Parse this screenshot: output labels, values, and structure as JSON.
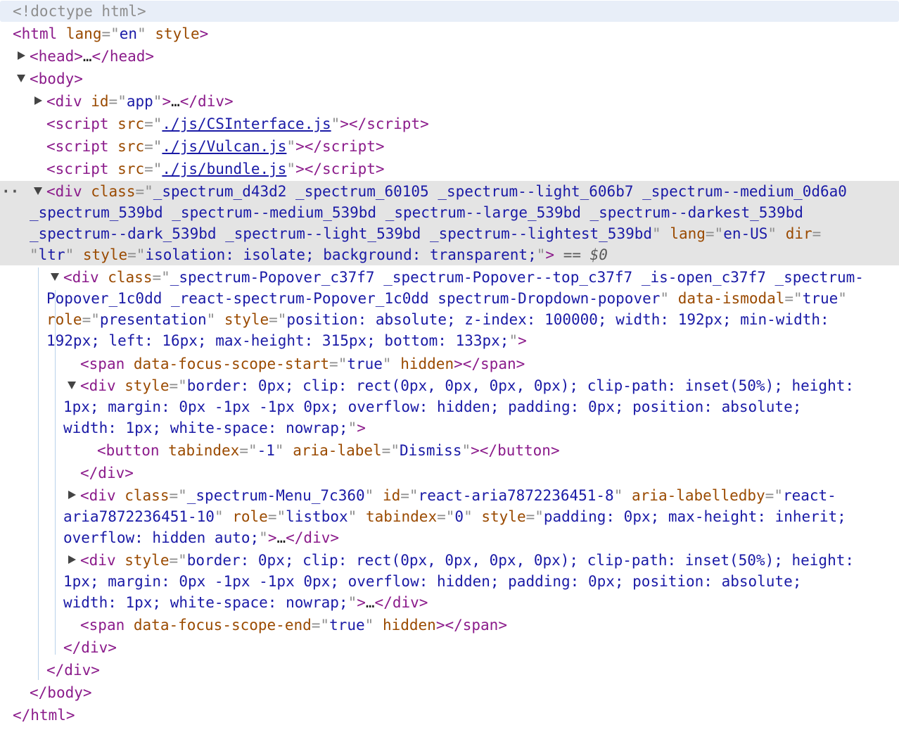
{
  "doctype": "<!doctype html>",
  "html_open": {
    "tag": "html",
    "attr_lang": "lang",
    "val_lang": "en",
    "attr_style": "style"
  },
  "head": {
    "tag": "head",
    "ellipsis": "…"
  },
  "body": {
    "tag": "body"
  },
  "app_div": {
    "tag": "div",
    "attr": "id",
    "val": "app",
    "ellipsis": "…"
  },
  "scripts": [
    {
      "tag": "script",
      "attr": "src",
      "val": "./js/CSInterface.js"
    },
    {
      "tag": "script",
      "attr": "src",
      "val": "./js/Vulcan.js"
    },
    {
      "tag": "script",
      "attr": "src",
      "val": "./js/bundle.js"
    }
  ],
  "spectrum_div": {
    "tag": "div",
    "attr_class": "class",
    "class_lines": [
      "_spectrum_d43d2 _spectrum_60105 _spectrum--light_606b7 _spectrum--medium_0d6a0",
      "_spectrum_539bd _spectrum--medium_539bd _spectrum--large_539bd _spectrum--darkest_539bd",
      "_spectrum--dark_539bd _spectrum--light_539bd _spectrum--lightest_539bd"
    ],
    "attr_lang": "lang",
    "val_lang": "en-US",
    "attr_dir": "dir",
    "val_dir": "ltr",
    "attr_style": "style",
    "val_style": "isolation: isolate; background: transparent;",
    "selected_marker": "== $0"
  },
  "popover_div": {
    "tag": "div",
    "attr_class": "class",
    "class_l1": "_spectrum-Popover_c37f7 _spectrum-Popover--top_c37f7 _is-open_c37f7 _spectrum-",
    "class_l2": "Popover_1c0dd _react-spectrum-Popover_1c0dd spectrum-Dropdown-popover",
    "attr_modal": "data-ismodal",
    "val_modal": "true",
    "attr_role": "role",
    "val_role": "presentation",
    "attr_style": "style",
    "style_l1": "position: absolute; z-index: 100000; width: 192px; min-width:",
    "style_l2": "192px; left: 16px; max-height: 315px; bottom: 133px;"
  },
  "focus_start": {
    "tag": "span",
    "attr": "data-focus-scope-start",
    "val": "true",
    "attr2": "hidden"
  },
  "hidden_div1": {
    "tag": "div",
    "attr": "style",
    "l1": "border: 0px; clip: rect(0px, 0px, 0px, 0px); clip-path: inset(50%); height:",
    "l2": "1px; margin: 0px -1px -1px 0px; overflow: hidden; padding: 0px; position: absolute;",
    "l3": "width: 1px; white-space: nowrap;"
  },
  "dismiss_button": {
    "tag": "button",
    "attr_tab": "tabindex",
    "val_tab": "-1",
    "attr_label": "aria-label",
    "val_label": "Dismiss"
  },
  "menu_div": {
    "tag": "div",
    "attr_class": "class",
    "val_class": "_spectrum-Menu_7c360",
    "attr_id": "id",
    "val_id": "react-aria7872236451-8",
    "attr_lb": "aria-labelledby",
    "val_lb_1": "react-",
    "val_lb_2": "aria7872236451-10",
    "attr_role": "role",
    "val_role": "listbox",
    "attr_tab": "tabindex",
    "val_tab": "0",
    "attr_style": "style",
    "style_l1": "padding: 0px; max-height: inherit;",
    "style_l2": "overflow: hidden auto;",
    "ellipsis": "…"
  },
  "hidden_div2": {
    "tag": "div",
    "attr": "style",
    "l1": "border: 0px; clip: rect(0px, 0px, 0px, 0px); clip-path: inset(50%); height:",
    "l2": "1px; margin: 0px -1px -1px 0px; overflow: hidden; padding: 0px; position: absolute;",
    "l3": "width: 1px; white-space: nowrap;",
    "ellipsis": "…"
  },
  "focus_end": {
    "tag": "span",
    "attr": "data-focus-scope-end",
    "val": "true",
    "attr2": "hidden"
  },
  "close_tags": {
    "div": "div",
    "body": "body",
    "html": "html"
  },
  "row_dots": "··"
}
